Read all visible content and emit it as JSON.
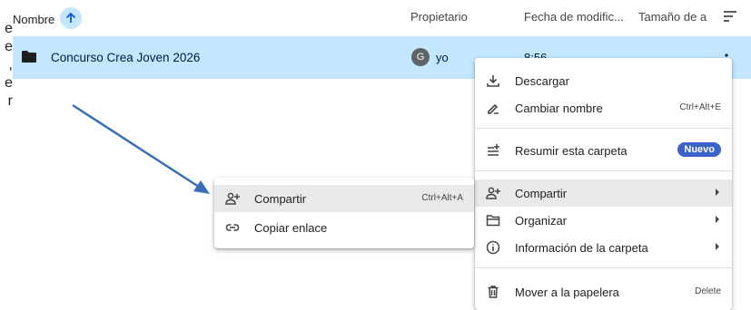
{
  "edge_fragment": [
    "e",
    "e",
    ",",
    "e",
    "r"
  ],
  "header": {
    "name_label": "Nombre",
    "owner_label": "Propietario",
    "modified_label": "Fecha de modific...",
    "size_label": "Tamaño de a"
  },
  "row": {
    "name": "Concurso Crea Joven 2026",
    "avatar_letter": "G",
    "owner": "yo",
    "modified": "8:56"
  },
  "main_menu": {
    "items": [
      {
        "label": "Descargar",
        "icon": "download-icon"
      },
      {
        "label": "Cambiar nombre",
        "icon": "rename-icon",
        "shortcut": "Ctrl+Alt+E"
      },
      {
        "label": "Resumir esta carpeta",
        "icon": "summarize-icon",
        "badge": "Nuevo"
      },
      {
        "label": "Compartir",
        "icon": "share-icon",
        "submenu": true
      },
      {
        "label": "Organizar",
        "icon": "organize-icon",
        "submenu": true
      },
      {
        "label": "Información de la carpeta",
        "icon": "info-icon",
        "submenu": true
      },
      {
        "label": "Mover a la papelera",
        "icon": "trash-icon",
        "shortcut": "Delete"
      }
    ]
  },
  "share_submenu": {
    "items": [
      {
        "label": "Compartir",
        "icon": "share-icon",
        "shortcut": "Ctrl+Alt+A"
      },
      {
        "label": "Copiar enlace",
        "icon": "link-icon"
      }
    ]
  },
  "colors": {
    "selected_row": "#c2e7ff",
    "badge": "#3a62c9",
    "annotation_arrow": "#3a6fb8"
  }
}
